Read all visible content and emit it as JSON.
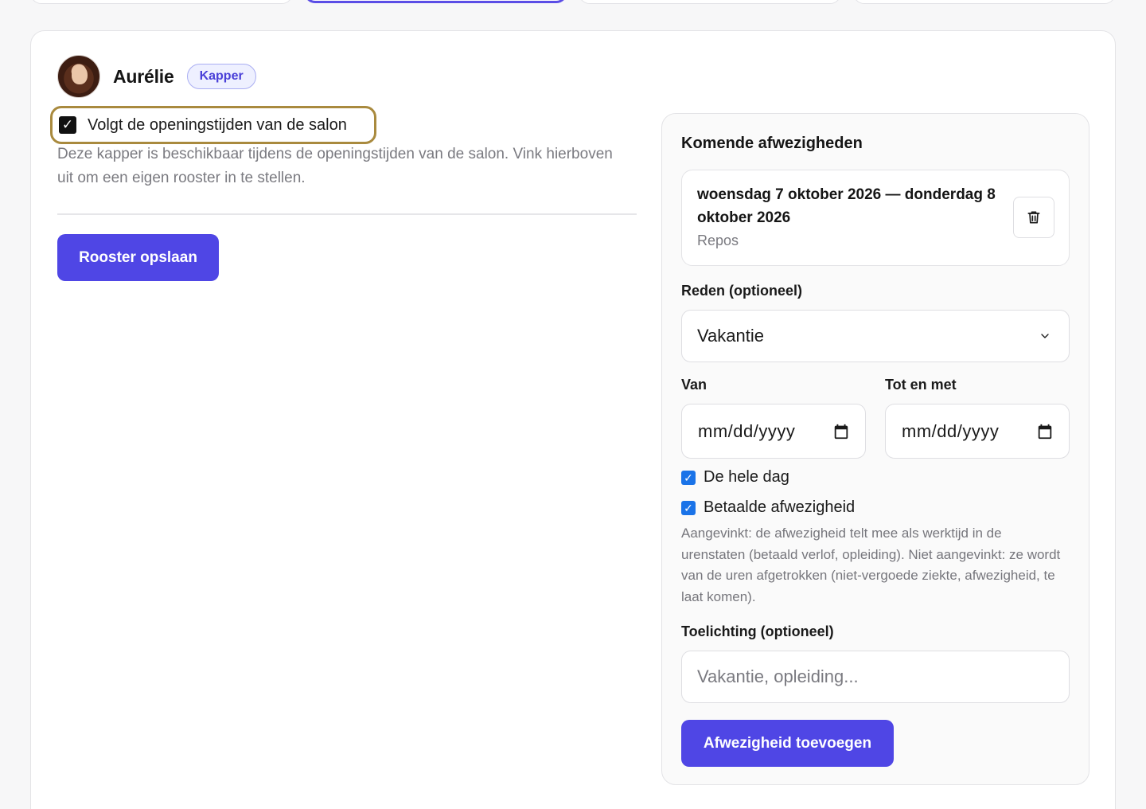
{
  "staff": {
    "name": "Aurélie",
    "role": "Kapper",
    "follows_salon_hours_label": "Volgt de openingstijden van de salon",
    "follows_salon_hours_checked": true,
    "follows_salon_hours_help": "Deze kapper is beschikbaar tijdens de openingstijden van de salon. Vink hierboven uit om een eigen rooster in te stellen.",
    "save_label": "Rooster opslaan"
  },
  "absences": {
    "title": "Komende afwezigheden",
    "items": [
      {
        "range": "woensdag 7 oktober 2026 — donderdag 8 oktober 2026",
        "reason": "Repos"
      }
    ],
    "form": {
      "reason_label": "Reden (optioneel)",
      "reason_value": "Vakantie",
      "from_label": "Van",
      "to_label": "Tot en met",
      "date_placeholder": "mm/dd/yyyy",
      "all_day_label": "De hele dag",
      "all_day_checked": true,
      "paid_label": "Betaalde afwezigheid",
      "paid_checked": true,
      "paid_help": "Aangevinkt: de afwezigheid telt mee als werktijd in de urenstaten (betaald verlof, opleiding). Niet aangevinkt: ze wordt van de uren afgetrokken (niet-vergoede ziekte, afwezigheid, te laat komen).",
      "note_label": "Toelichting (optioneel)",
      "note_placeholder": "Vakantie, opleiding...",
      "submit_label": "Afwezigheid toevoegen"
    }
  },
  "colors": {
    "accent": "#4f46e5",
    "highlight_border": "#a98a3e",
    "checkbox_blue": "#1a73e8"
  }
}
